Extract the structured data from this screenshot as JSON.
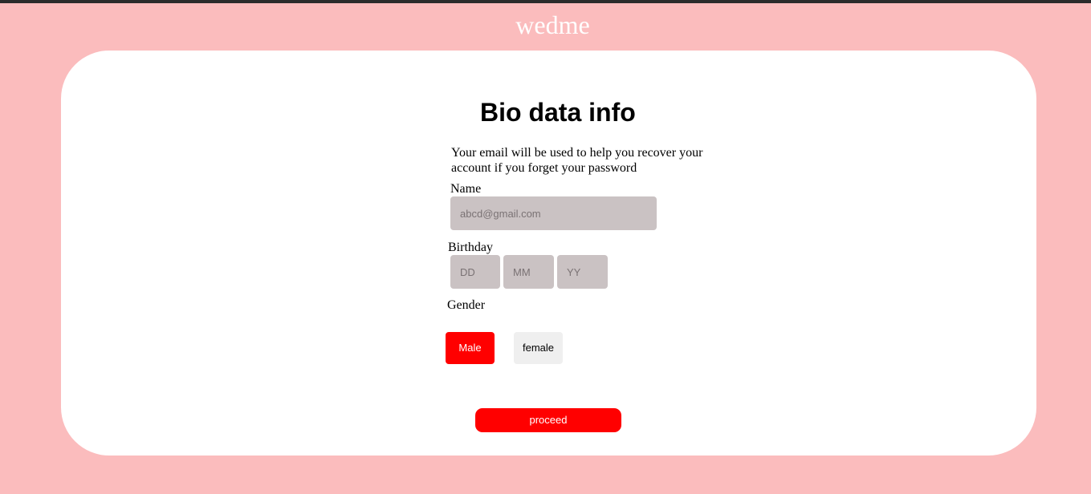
{
  "header": {
    "brand": "wedme"
  },
  "form": {
    "title": "Bio data info",
    "note": "Your email will be used to help you recover your account if you forget your password",
    "name_label": "Name",
    "name_placeholder": "abcd@gmail.com",
    "birthday_label": "Birthday",
    "day_placeholder": "DD",
    "month_placeholder": "MM",
    "year_placeholder": "YY",
    "gender_label": "Gender",
    "gender_options": [
      "Male",
      "female"
    ],
    "selected_gender": "Male",
    "proceed_label": "proceed"
  },
  "colors": {
    "page_background": "#fbbcbd",
    "accent": "#ff0000",
    "input_background": "#cac2c3",
    "card_background": "#ffffff"
  }
}
